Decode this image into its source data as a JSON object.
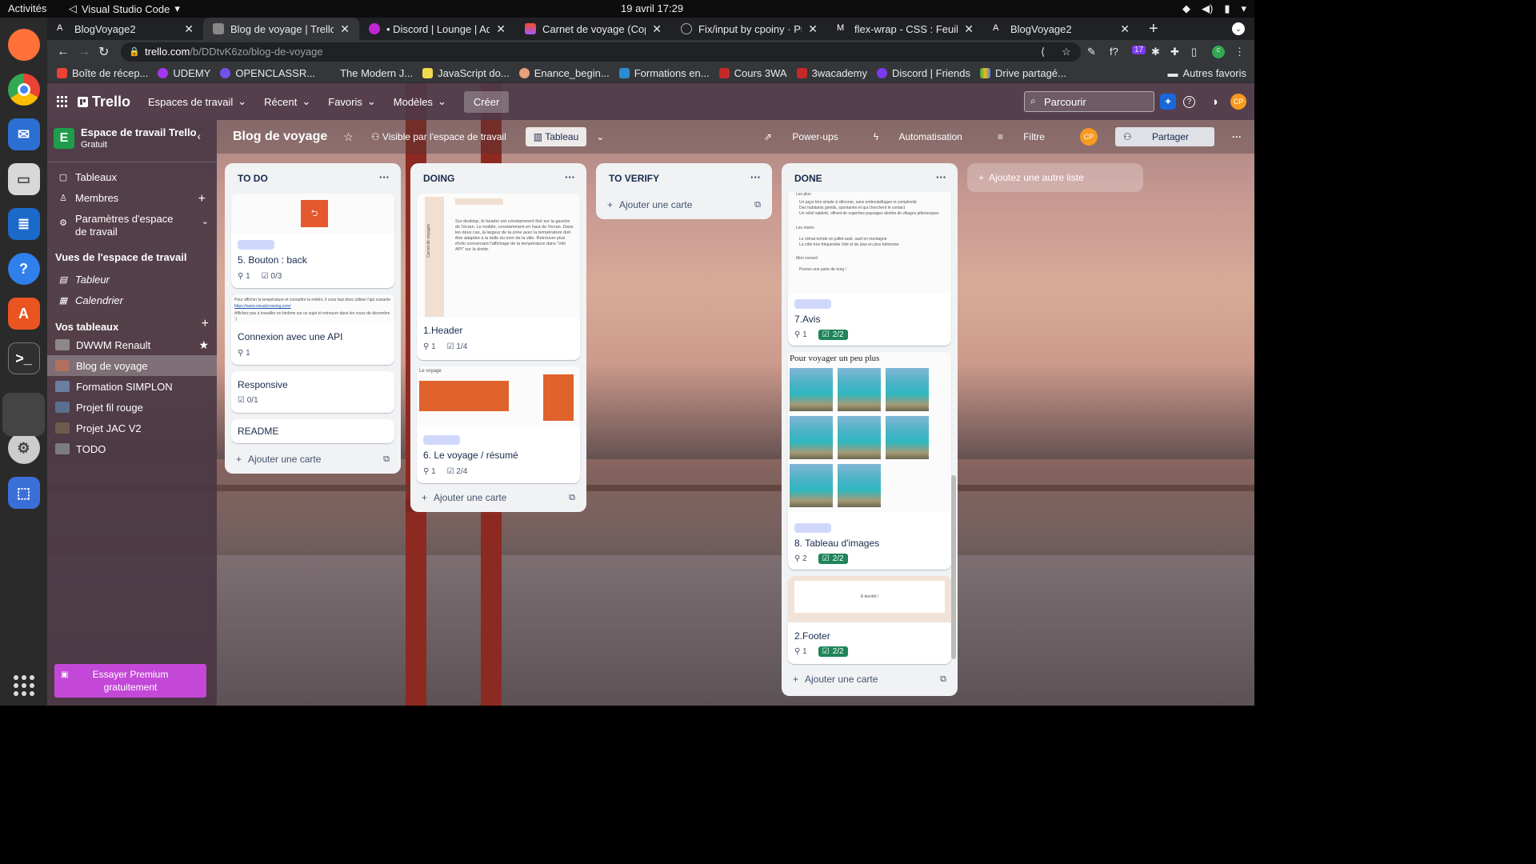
{
  "os": {
    "activities": "Activités",
    "active_app": "Visual Studio Code",
    "clock": "19 avril  17:29"
  },
  "browser": {
    "tabs": [
      {
        "title": "BlogVoyage2",
        "fav": "#202124",
        "fav_text": "A"
      },
      {
        "title": "Blog de voyage | Trello",
        "fav": "#555",
        "fav_text": ""
      },
      {
        "title": "• Discord | Lounge | Adam",
        "fav": "#7c3aed",
        "fav_text": ""
      },
      {
        "title": "Carnet de voyage (Copy) –",
        "fav": "#f24e1e",
        "fav_text": ""
      },
      {
        "title": "Fix/input by cpoiny · Pull F",
        "fav": "#202124",
        "fav_text": ""
      },
      {
        "title": "flex-wrap - CSS : Feuilles d",
        "fav": "#202124",
        "fav_text": "M"
      },
      {
        "title": "BlogVoyage2",
        "fav": "#202124",
        "fav_text": "A"
      }
    ],
    "url_host": "trello.com",
    "url_path": "/b/DDtvK6zo/blog-de-voyage",
    "bookmarks": [
      {
        "label": "Boîte de récep...",
        "color": "#ea4335"
      },
      {
        "label": "UDEMY",
        "color": "#a435f0"
      },
      {
        "label": "OPENCLASSR...",
        "color": "#7451eb"
      },
      {
        "label": "The Modern J...",
        "color": "#35363a"
      },
      {
        "label": "JavaScript do...",
        "color": "#f0db4f"
      },
      {
        "label": "Enance_begin...",
        "color": "#e8a07a"
      },
      {
        "label": "Formations en...",
        "color": "#2b8ccf"
      },
      {
        "label": "Cours 3WA",
        "color": "#c62828"
      },
      {
        "label": "3wacademy",
        "color": "#c62828"
      },
      {
        "label": "Discord | Friends",
        "color": "#7c3aed"
      },
      {
        "label": "Drive partagé...",
        "color": "#34a853"
      }
    ],
    "other_bookmarks": "Autres favoris",
    "extension_badge": "17"
  },
  "trello": {
    "logo": "Trello",
    "menus": [
      "Espaces de travail",
      "Récent",
      "Favoris",
      "Modèles"
    ],
    "create": "Créer",
    "search_placeholder": "Parcourir",
    "avatar": "CP",
    "sidebar": {
      "workspace_initial": "E",
      "workspace_name": "Espace de travail Trello",
      "workspace_plan": "Gratuit",
      "items": [
        {
          "label": "Tableaux",
          "icon": "board-icon"
        },
        {
          "label": "Membres",
          "icon": "members-icon"
        },
        {
          "label": "Paramètres d'espace de travail",
          "icon": "gear-icon"
        }
      ],
      "views_heading": "Vues de l'espace de travail",
      "views": [
        "Tableur",
        "Calendrier"
      ],
      "boards_heading": "Vos tableaux",
      "boards": [
        {
          "label": "DWWM Renault",
          "thumb": "#8c8888",
          "starred": true
        },
        {
          "label": "Blog de voyage",
          "thumb": "#b07060",
          "starred": false,
          "selected": true
        },
        {
          "label": "Formation SIMPLON",
          "thumb": "#6a7fa0",
          "starred": false
        },
        {
          "label": "Projet fil rouge",
          "thumb": "#5a6f8e",
          "starred": false
        },
        {
          "label": "Projet JAC V2",
          "thumb": "#6d5a4c",
          "starred": false
        },
        {
          "label": "TODO",
          "thumb": "#7c7c7c",
          "starred": false
        }
      ],
      "premium": "Essayer Premium gratuitement"
    },
    "board": {
      "title": "Blog de voyage",
      "visibility": "Visible par l'espace de travail",
      "view": "Tableau",
      "powerups": "Power-ups",
      "automation": "Automatisation",
      "filter": "Filtre",
      "share": "Partager"
    },
    "lists": {
      "todo": {
        "title": "TO DO",
        "cards": [
          {
            "title": "5. Bouton : back",
            "attachments": "1",
            "checklist": "0/3"
          },
          {
            "title": "Connexion avec une API",
            "attachments": "1"
          },
          {
            "title": "Responsive",
            "checklist": "0/1"
          },
          {
            "title": "README"
          }
        ],
        "cover_text_1": "Pour afficher la température et connaître la météo, il vous faut donc utiliser l'api suivante :",
        "cover_text_2": "https://www.visualcrossing.com/",
        "cover_text_3": "Affichez pas à travailler en binôme sur ce sujet et retrouver dans les cours de décembre :)"
      },
      "doing": {
        "title": "DOING",
        "cards": [
          {
            "title": "1.Header",
            "attachments": "1",
            "checklist": "1/4"
          },
          {
            "title": "6. Le voyage / résumé",
            "attachments": "1",
            "checklist": "2/4"
          }
        ],
        "cover_side": "Carnet de voyages",
        "cover_text": "Sur desktop, le header est constamment fixé sur la gauche de l'écran. Le mobile, constamment en haut de l'écran. Dans les deux cas, la largeur de la zone avec la température doit être adaptée à la taille du nom de la ville. Retrouver plus d'info concernant l'affichage de la température dans \"info API\" sur la droite.",
        "cover2_title": "Le voyage"
      },
      "verify": {
        "title": "TO VERIFY"
      },
      "done": {
        "title": "DONE",
        "cards": [
          {
            "title": "7.Avis",
            "attachments": "1",
            "checklist": "2/2"
          },
          {
            "title": "8. Tableau d'images",
            "attachments": "2",
            "checklist": "2/2"
          },
          {
            "title": "2.Footer",
            "attachments": "1",
            "checklist": "2/2"
          }
        ],
        "cover_heading": "Les plus",
        "cover_lines": [
          "Un pays très simple à sillonner, sans embouteillages ni complexité",
          "Des habitants gentils, spontanés et qui cherchent le contact",
          "Un relief sableté, offrant de superbes paysages dentés de villages pittoresques",
          "Les moins",
          "Le climat torride en juillet-août, sauf en montagne",
          "La côte très fréquentée l'été et de plus en plus bétonnée",
          "Mon conseil",
          "Prenez une paire de tong !"
        ],
        "images_heading": "Pour voyager un peu plus",
        "footer_cover": "À bientôt !"
      },
      "add_card": "Ajouter une carte",
      "add_list": "Ajoutez une autre liste"
    }
  }
}
